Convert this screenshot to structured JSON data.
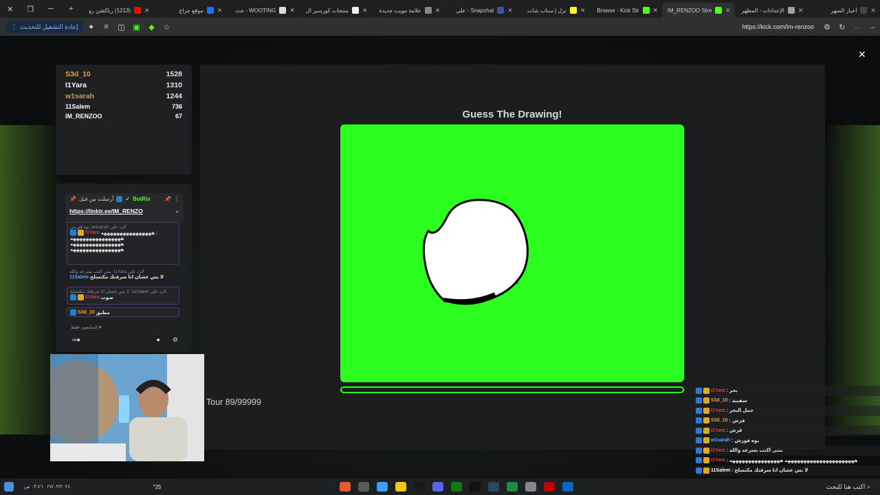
{
  "browser": {
    "tabs": [
      {
        "title": "أخبار السهر",
        "color": "#444444",
        "active": false
      },
      {
        "title": "الإعدادات - المظهر",
        "color": "#9aa0a6",
        "active": false
      },
      {
        "title": "IM_RENZOO Stre",
        "color": "#53fc18",
        "active": true
      },
      {
        "title": "Browse - Kick Str",
        "color": "#53fc18",
        "active": false
      },
      {
        "title": "نزل | سناب شات",
        "color": "#fffc00",
        "active": false
      },
      {
        "title": "Snapchat - علي",
        "color": "#3b5998",
        "active": false
      },
      {
        "title": "علامة تبويب جديدة",
        "color": "#888888",
        "active": false
      },
      {
        "title": "منتجات كورسير ال",
        "color": "#eeeeee",
        "active": false
      },
      {
        "title": "WOOTING - حث",
        "color": "#dddddd",
        "active": false
      },
      {
        "title": "موقع جراج",
        "color": "#1a73e8",
        "active": false
      },
      {
        "title": "(1213) رياكشن رو",
        "color": "#ff0000",
        "active": false
      }
    ],
    "update_label": "إعادة التشغيل للتحديث",
    "url": "https://kick.com/im-renzoo"
  },
  "leaderboard": [
    {
      "name": "S3d_10",
      "score": "1528",
      "color": "#e6a23c"
    },
    {
      "name": "I1Yara",
      "score": "1310",
      "color": "#ffffff"
    },
    {
      "name": "w1sarah",
      "score": "1244",
      "color": "#c89a5a"
    },
    {
      "name": "11Salem",
      "score": "736",
      "color": "#ffffff"
    },
    {
      "name": "IM_RENZOO",
      "score": "67",
      "color": "#ffffff"
    }
  ],
  "overlay_chat": {
    "pinned_prefix": "أرسلت من قبل",
    "pinned_user": "BotRix",
    "pinned_link": "https://linktr.ee/IM_RENZO",
    "reply1": "الرد على w1sarah: بوه قورش",
    "msg1_user": "I1Yara",
    "msg1_lines": [
      "ههههههههههههههههه :",
      "ههههههههههههههههه",
      "ههههههههههههههههه",
      "ههههههههههههههههه"
    ],
    "reply2": "الرد على I1Yara: بنتي اكتب بسرعه والله",
    "msg2_user": "11Salem",
    "msg2_text": "لا بس عشان انا سرقتك مكتسلح",
    "reply3": "الرد على 11Salem: لا بس عشان انا سرقتك مكتسلح",
    "msg3_user": "I1Yara",
    "msg3_text": "صوت",
    "msg4_user": "S3d_10",
    "msg4_text": "مطنق",
    "followers_only": "المتابعون فقط"
  },
  "game": {
    "title": "Guess The Drawing!",
    "tour": "Tour 89/99999",
    "progress": 0.0,
    "canvas_color": "#2bff1d"
  },
  "right_chat": [
    {
      "user": "I1Yara",
      "color": "#e33b3b",
      "text": ": بحر"
    },
    {
      "user": "S3d_10",
      "color": "#ff9a3c",
      "text": ": سفينة"
    },
    {
      "user": "I1Yara",
      "color": "#e33b3b",
      "text": ": جمل البحر"
    },
    {
      "user": "S3d_10",
      "color": "#ff9a3c",
      "text": ": قرش"
    },
    {
      "user": "I1Yara",
      "color": "#e33b3b",
      "text": ": قرش"
    },
    {
      "user": "w1sarah",
      "color": "#53b4ff",
      "text": ": بوه قورش"
    },
    {
      "user": "I1Yara",
      "color": "#e33b3b",
      "text": ": بنتي اكتب بسرعه والله"
    },
    {
      "user": "I1Yara",
      "color": "#e33b3b",
      "text": ": ههههههههههههههههههههههه ههههههههههههههههه"
    },
    {
      "user": "11Salem",
      "color": "#ffffff",
      "text": ": لا بس عشان انا سرقتك مكتسلح"
    }
  ],
  "taskbar": {
    "time": "٠٣:٤٦ ص",
    "date": "٢٧/٠٣/٢٠٢٤",
    "temp": "°25",
    "search_placeholder": "اكتب هنا للبحث"
  }
}
